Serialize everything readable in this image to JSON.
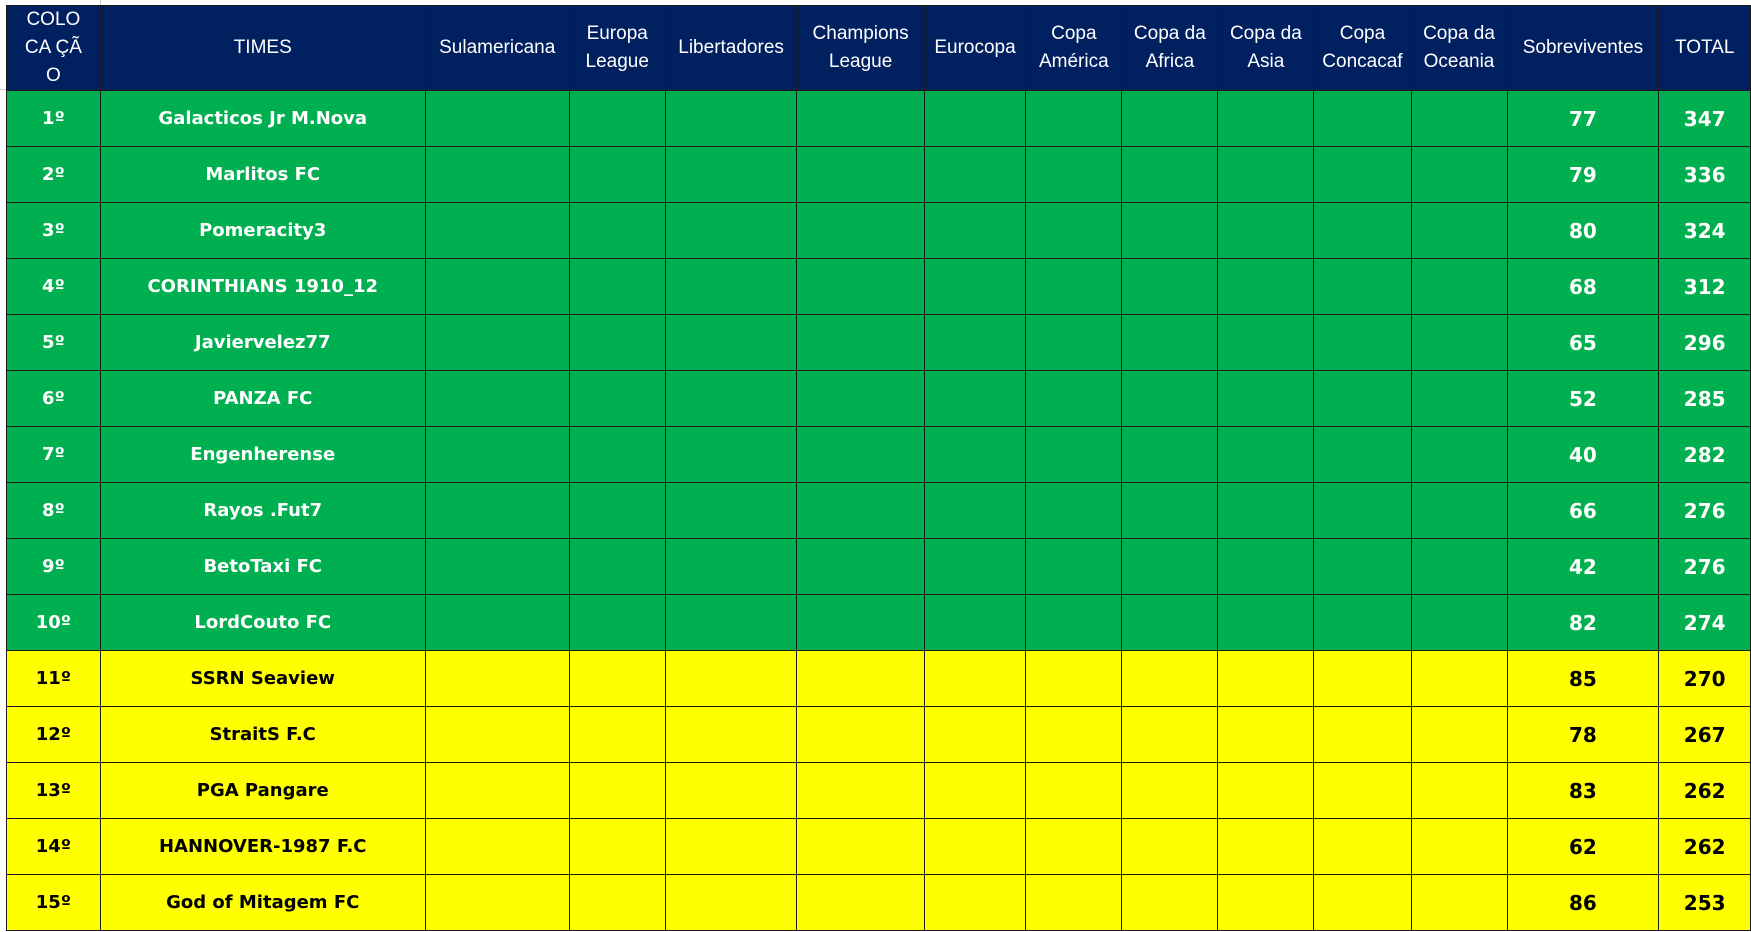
{
  "sheet": {
    "colors": {
      "header_bg": "#002060",
      "header_text": "#ffffff",
      "green_zone": "#00b050",
      "yellow_zone": "#ffff00",
      "grid": "#1a1a1a"
    },
    "headers": {
      "position": "COLOCA ÇÃO",
      "team": "TIMES",
      "sulamericana": "Sulamericana",
      "europa_league": "Europa League",
      "libertadores": "Libertadores",
      "champions_league": "Champions League",
      "eurocopa": "Eurocopa",
      "copa_america": "Copa América",
      "copa_africa": "Copa da Africa",
      "copa_asia": "Copa da Asia",
      "copa_concacaf": "Copa Concacaf",
      "copa_oceania": "Copa da Oceania",
      "sobreviventes": "Sobreviventes",
      "total": "TOTAL"
    },
    "rows": [
      {
        "zone": "green",
        "position": "1º",
        "team": "Galacticos Jr M.Nova",
        "sobreviventes": "77",
        "total": "347"
      },
      {
        "zone": "green",
        "position": "2º",
        "team": "Marlitos FC",
        "sobreviventes": "79",
        "total": "336"
      },
      {
        "zone": "green",
        "position": "3º",
        "team": "Pomeracity3",
        "sobreviventes": "80",
        "total": "324"
      },
      {
        "zone": "green",
        "position": "4º",
        "team": "CORINTHIANS 1910_12",
        "sobreviventes": "68",
        "total": "312"
      },
      {
        "zone": "green",
        "position": "5º",
        "team": "Javiervelez77",
        "sobreviventes": "65",
        "total": "296"
      },
      {
        "zone": "green",
        "position": "6º",
        "team": "PANZA FC",
        "sobreviventes": "52",
        "total": "285"
      },
      {
        "zone": "green",
        "position": "7º",
        "team": "Engenherense",
        "sobreviventes": "40",
        "total": "282"
      },
      {
        "zone": "green",
        "position": "8º",
        "team": "Rayos .Fut7",
        "sobreviventes": "66",
        "total": "276"
      },
      {
        "zone": "green",
        "position": "9º",
        "team": "BetoTaxi FC",
        "sobreviventes": "42",
        "total": "276"
      },
      {
        "zone": "green",
        "position": "10º",
        "team": "LordCouto FC",
        "sobreviventes": "82",
        "total": "274"
      },
      {
        "zone": "yellow",
        "position": "11º",
        "team": "SSRN Seaview",
        "sobreviventes": "85",
        "total": "270"
      },
      {
        "zone": "yellow",
        "position": "12º",
        "team": "StraitS F.C",
        "sobreviventes": "78",
        "total": "267"
      },
      {
        "zone": "yellow",
        "position": "13º",
        "team": "PGA Pangare",
        "sobreviventes": "83",
        "total": "262"
      },
      {
        "zone": "yellow",
        "position": "14º",
        "team": "HANNOVER-1987 F.C",
        "sobreviventes": "62",
        "total": "262"
      },
      {
        "zone": "yellow",
        "position": "15º",
        "team": "God of Mitagem FC",
        "sobreviventes": "86",
        "total": "253"
      }
    ]
  }
}
